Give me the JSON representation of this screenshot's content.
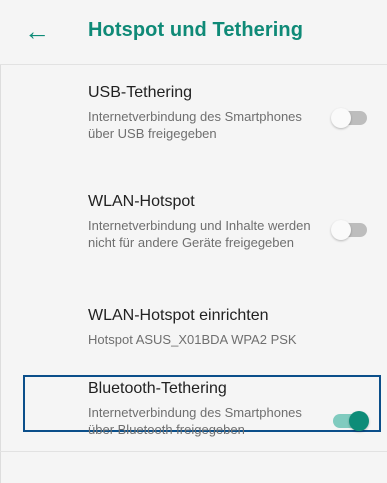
{
  "header": {
    "title": "Hotspot und Tethering",
    "back_icon": "arrow-left-icon"
  },
  "items": [
    {
      "title": "USB-Tethering",
      "summary": "Internetverbindung des Smartphones über USB freigegeben",
      "toggle": "off"
    },
    {
      "title": "WLAN-Hotspot",
      "summary": "Internetverbindung und Inhalte werden nicht für andere Geräte freigegeben",
      "toggle": "off"
    },
    {
      "title": "WLAN-Hotspot einrichten",
      "summary": "Hotspot ASUS_X01BDA WPA2 PSK"
    },
    {
      "title": "Bluetooth-Tethering",
      "summary": "Internetverbindung des Smartphones über Bluetooth freigegeben",
      "toggle": "on"
    }
  ],
  "colors": {
    "accent": "#0e8c78",
    "highlight_border": "#0b4f8a"
  }
}
